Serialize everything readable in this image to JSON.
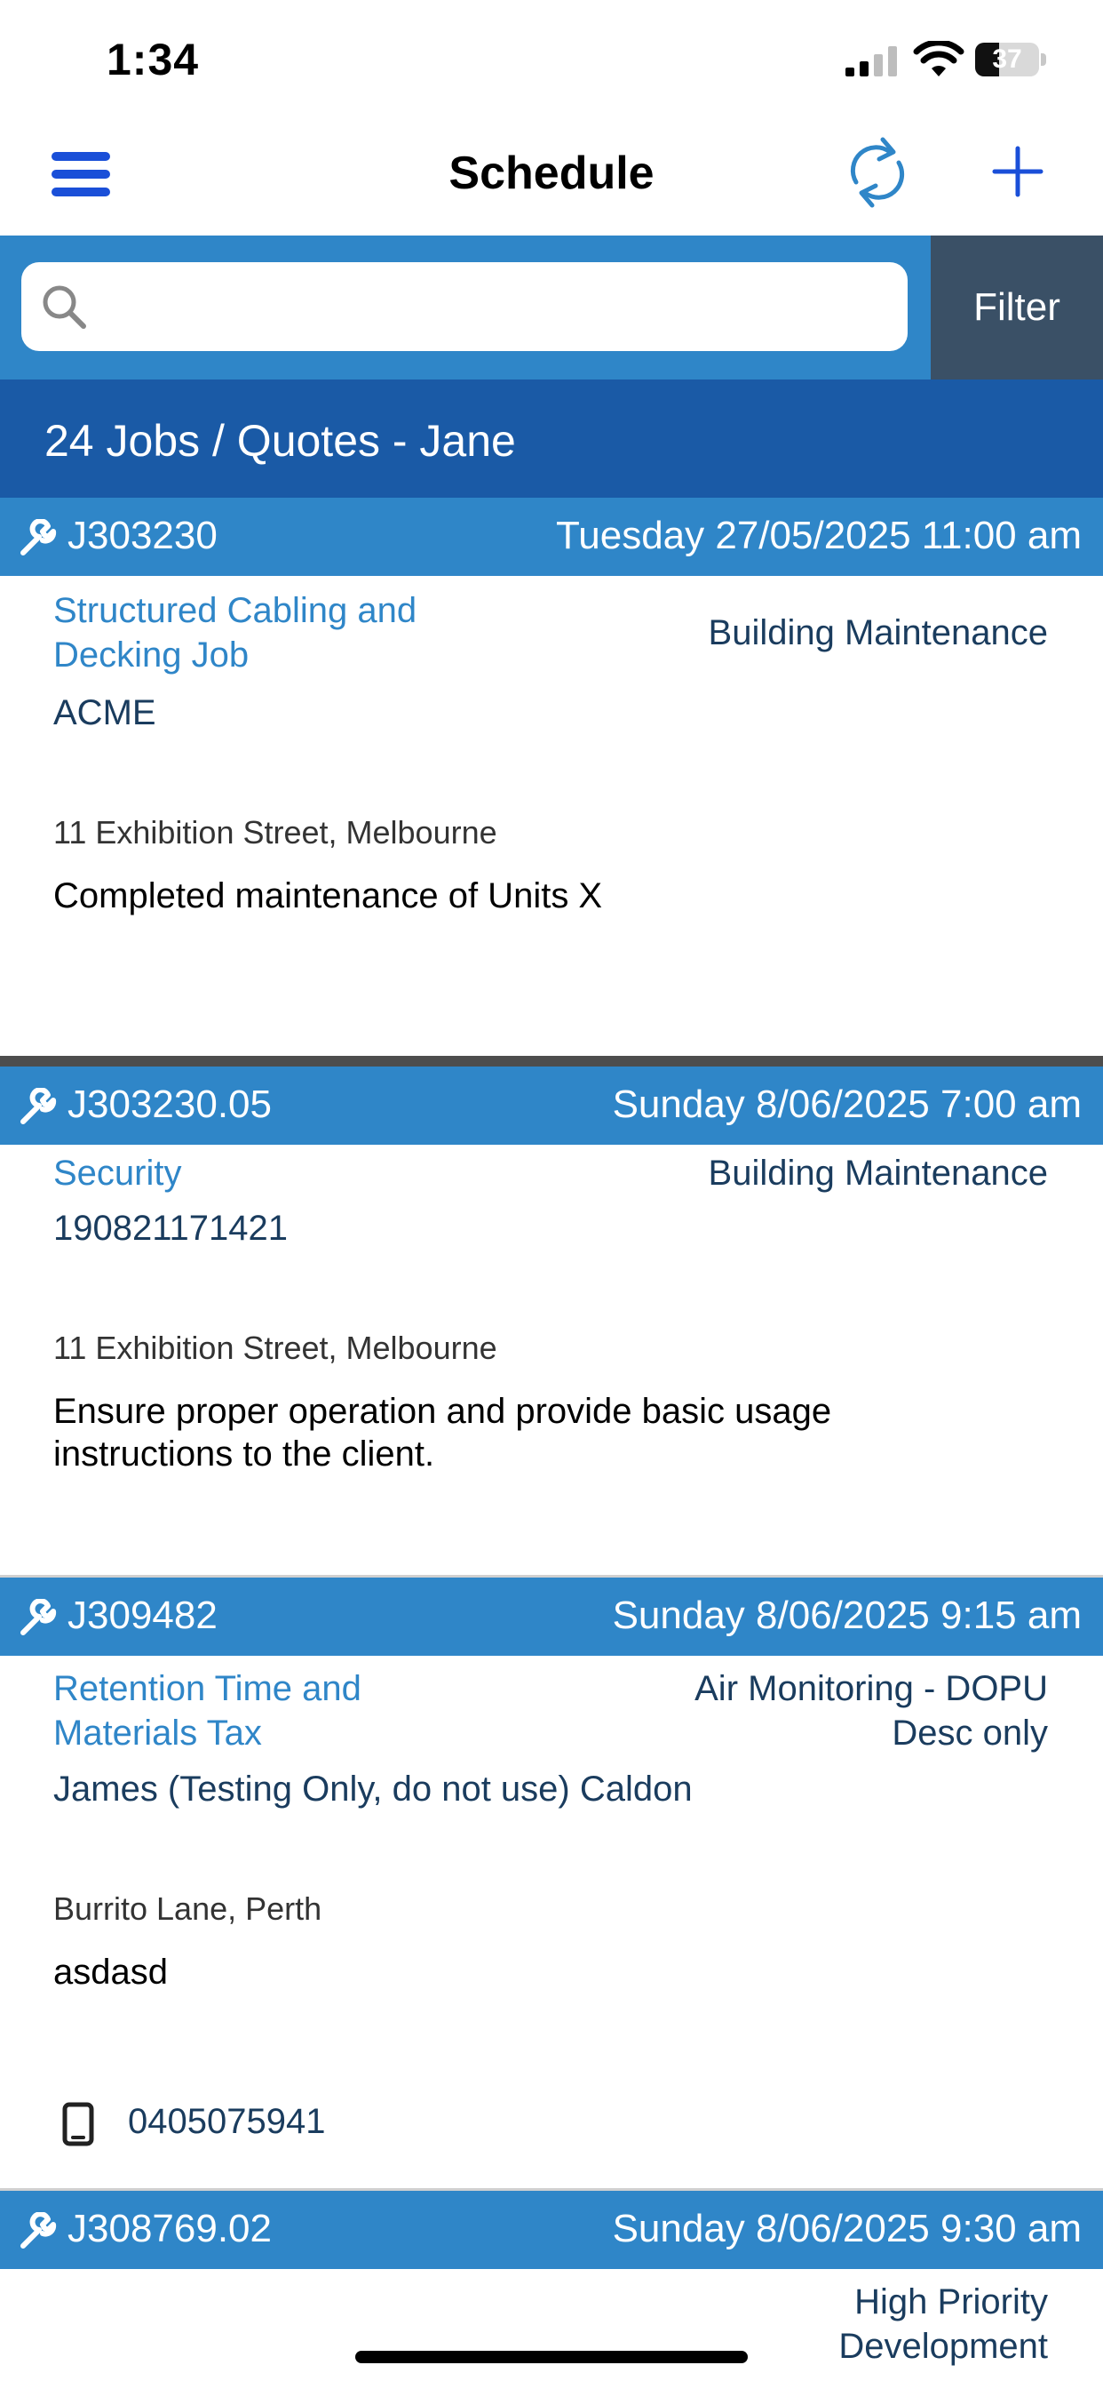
{
  "status_bar": {
    "time": "1:34",
    "battery": {
      "level": "37",
      "fraction": 0.37
    }
  },
  "nav": {
    "title": "Schedule"
  },
  "search": {
    "value": "",
    "placeholder": ""
  },
  "filter": {
    "label": "Filter"
  },
  "jobs_header": {
    "text": "24 Jobs / Quotes - Jane"
  },
  "jobs": [
    {
      "id": "J303230",
      "date": "Tuesday 27/05/2025 11:00 am",
      "title_lines": [
        "Structured Cabling and",
        "Decking Job"
      ],
      "category_lines": [
        "Building Maintenance"
      ],
      "client": "ACME",
      "address": "11 Exhibition Street, Melbourne",
      "description_lines": [
        "Completed maintenance of Units X"
      ]
    },
    {
      "id": "J303230.05",
      "date": "Sunday 8/06/2025 7:00 am",
      "title_lines": [
        "Security"
      ],
      "category_lines": [
        "Building Maintenance"
      ],
      "client": "190821171421",
      "address": "11 Exhibition Street, Melbourne",
      "description_lines": [
        "Ensure proper operation and provide basic usage",
        "instructions to the client."
      ]
    },
    {
      "id": "J309482",
      "date": "Sunday 8/06/2025 9:15 am",
      "title_lines": [
        "Retention Time and",
        "Materials Tax"
      ],
      "category_lines": [
        "Air Monitoring - DOPU",
        "Desc only"
      ],
      "client": "James (Testing Only, do not use) Caldon",
      "address": "Burrito Lane, Perth",
      "description_lines": [
        "asdasd"
      ],
      "phone": "0405075941"
    },
    {
      "id": "J308769.02",
      "date": "Sunday 8/06/2025 9:30 am",
      "category_lines": [
        "High Priority",
        "Development"
      ]
    }
  ],
  "colors": {
    "header_blue": "#2f86c8",
    "count_header_blue": "#1a5aa6",
    "filter_bg": "#3a5066",
    "accent_blue": "#1a4fd8"
  }
}
